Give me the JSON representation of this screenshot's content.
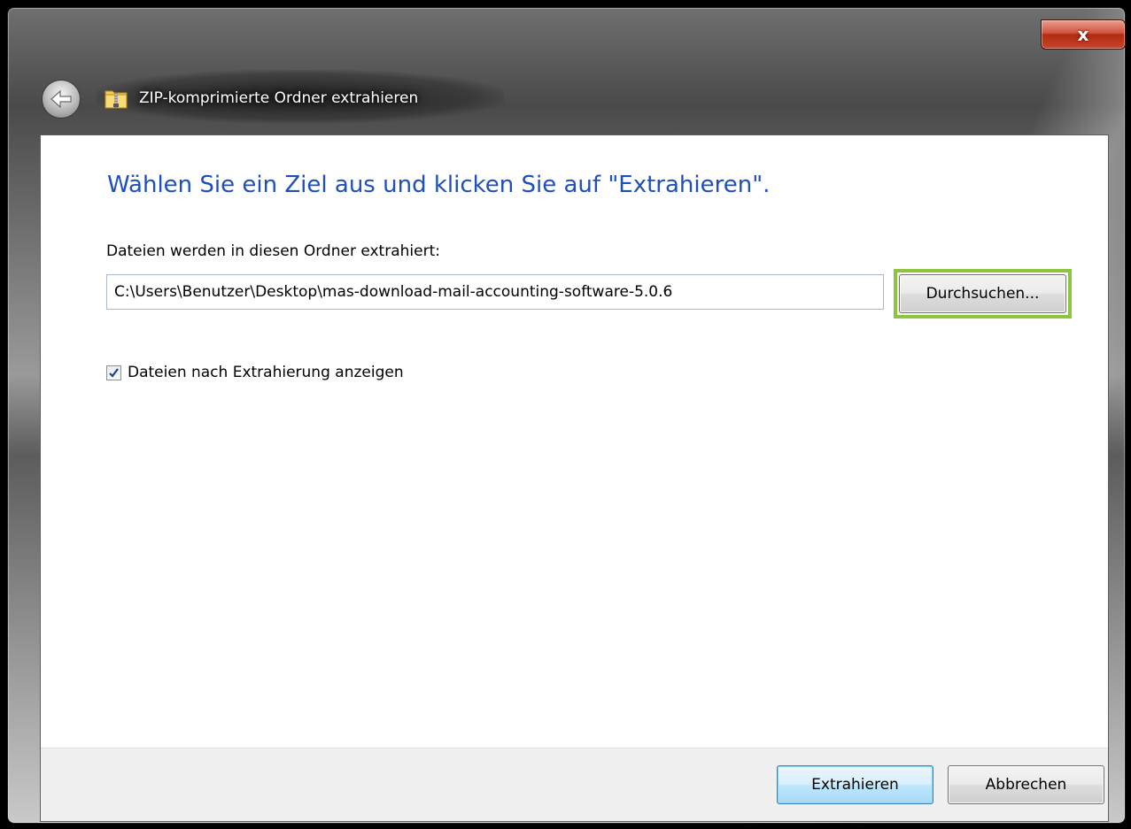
{
  "window": {
    "title": "ZIP-komprimierte Ordner extrahieren",
    "close_label": "x"
  },
  "main": {
    "heading": "Wählen Sie ein Ziel aus und klicken Sie auf \"Extrahieren\".",
    "folder_label": "Dateien werden in diesen Ordner extrahiert:",
    "path_value": "C:\\Users\\Benutzer\\Desktop\\mas-download-mail-accounting-software-5.0.6",
    "browse_label": "Durchsuchen...",
    "show_files_label": "Dateien nach Extrahierung anzeigen",
    "show_files_checked": true
  },
  "footer": {
    "extract_label": "Extrahieren",
    "cancel_label": "Abbrechen"
  },
  "colors": {
    "heading": "#1e4fbd",
    "highlight": "#8cc63f",
    "close_button": "#c9452a"
  },
  "icons": {
    "back": "back-arrow-icon",
    "title": "zip-folder-icon",
    "close": "close-icon",
    "check": "checkmark-icon"
  }
}
